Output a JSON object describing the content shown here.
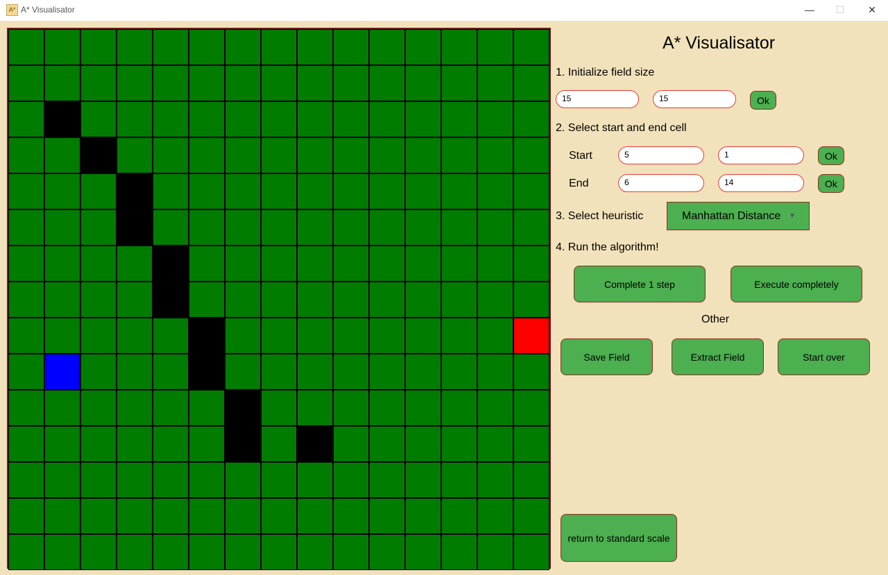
{
  "window": {
    "title": "A* Visualisator",
    "icon_text": "A*",
    "minimize": "—",
    "maximize": "☐",
    "close": "✕"
  },
  "grid": {
    "rows": 15,
    "cols": 15,
    "colors": {
      "empty": "#007c00",
      "wall": "#000000",
      "start": "#0000ff",
      "end": "#ff0000"
    },
    "walls": [
      [
        2,
        1
      ],
      [
        3,
        2
      ],
      [
        4,
        3
      ],
      [
        5,
        3
      ],
      [
        6,
        4
      ],
      [
        7,
        4
      ],
      [
        8,
        5
      ],
      [
        9,
        5
      ],
      [
        10,
        6
      ],
      [
        11,
        6
      ],
      [
        11,
        8
      ]
    ],
    "start": [
      9,
      1
    ],
    "end": [
      8,
      14
    ]
  },
  "panel": {
    "title": "A* Visualisator",
    "step1": {
      "label": "1. Initialize field size",
      "width": "15",
      "height": "15",
      "ok": "Ok"
    },
    "step2": {
      "label": "2. Select start and end cell",
      "start_label": "Start",
      "start_x": "5",
      "start_y": "1",
      "start_ok": "Ok",
      "end_label": "End",
      "end_x": "6",
      "end_y": "14",
      "end_ok": "Ok"
    },
    "step3": {
      "label": "3. Select heuristic",
      "heuristic": "Manhattan Distance",
      "caret": "▼"
    },
    "step4": {
      "label": "4. Run the algorithm!",
      "step_btn": "Complete 1 step",
      "exec_btn": "Execute completely"
    },
    "other": {
      "label": "Other",
      "save": "Save Field",
      "extract": "Extract Field",
      "restart": "Start over"
    },
    "scale_btn": "return to standard scale"
  }
}
